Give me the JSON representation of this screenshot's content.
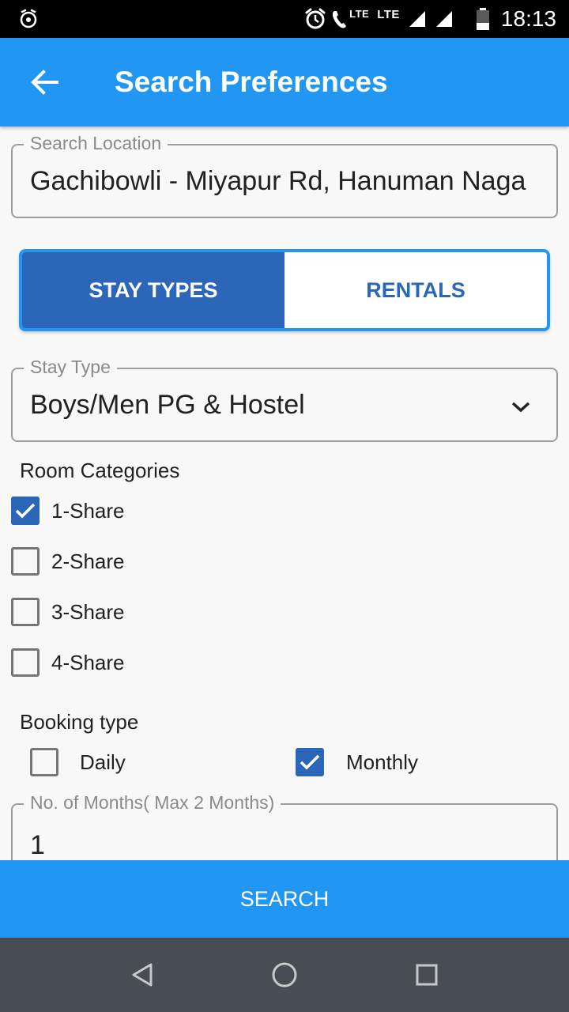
{
  "status_bar": {
    "lte1": "LTE",
    "lte2": "LTE",
    "time": "18:13"
  },
  "app_bar": {
    "title": "Search Preferences",
    "back_icon": "arrow-back-icon"
  },
  "search_location": {
    "label": "Search Location",
    "value": "Gachibowli - Miyapur Rd, Hanuman Naga"
  },
  "tabs": [
    {
      "label": "STAY TYPES",
      "active": true
    },
    {
      "label": "RENTALS",
      "active": false
    }
  ],
  "stay_type": {
    "label": "Stay Type",
    "value": "Boys/Men PG & Hostel"
  },
  "room_categories": {
    "title": "Room Categories",
    "items": [
      {
        "label": "1-Share",
        "checked": true
      },
      {
        "label": "2-Share",
        "checked": false
      },
      {
        "label": "3-Share",
        "checked": false
      },
      {
        "label": "4-Share",
        "checked": false
      }
    ]
  },
  "booking_type": {
    "title": "Booking type",
    "options": [
      {
        "label": "Daily",
        "checked": false
      },
      {
        "label": "Monthly",
        "checked": true
      }
    ]
  },
  "months": {
    "label": "No. of Months( Max 2 Months)",
    "value": "1"
  },
  "search_button": "SEARCH",
  "colors": {
    "primary": "#2196f3",
    "accent_dark": "#2b66b8",
    "nav_bar": "#474d52"
  }
}
